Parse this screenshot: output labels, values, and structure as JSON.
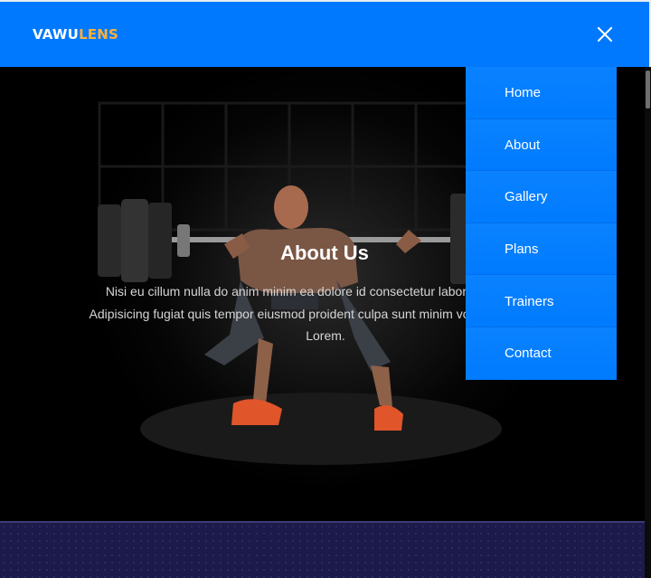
{
  "brand": {
    "part1": "VAWU",
    "part2": "LENS"
  },
  "header": {
    "close_icon": "close-icon"
  },
  "hero": {
    "title": "About Us",
    "description": "Nisi eu cillum nulla do anim minim ea dolore id consectetur labore consectetur. Adipisicing fugiat quis tempor eiusmod proident culpa sunt minim voluptate occaecat Lorem."
  },
  "menu": {
    "items": [
      {
        "label": "Home"
      },
      {
        "label": "About"
      },
      {
        "label": "Gallery"
      },
      {
        "label": "Plans"
      },
      {
        "label": "Trainers"
      },
      {
        "label": "Contact"
      }
    ]
  },
  "colors": {
    "navbar": "#0079ff",
    "brand_accent": "#ffb037",
    "menu_bg": "#007bff",
    "bottom_bg": "#1b1a4a"
  }
}
